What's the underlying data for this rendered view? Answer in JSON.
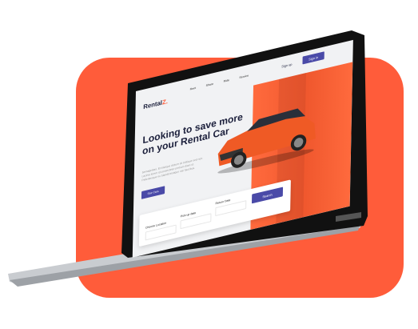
{
  "brand": {
    "name": "Rental",
    "suffix": "Z."
  },
  "nav": [
    "Rent",
    "Share",
    "Ride",
    "Service"
  ],
  "auth": {
    "sign_up": "Sign up",
    "sign_in": "Sign in"
  },
  "hero": {
    "title": "Looking to save more on your Rental Car",
    "description": "Semagestas. Et tristique dictum sit tristique sed non. Lacinia lorem id consectetur pretium diam ut. Pellentesque eu blandit tristique nisi faucibus.",
    "cta": "See Cars"
  },
  "search": {
    "location": "Choose Location",
    "pickup": "Pick-up date",
    "return": "Return Date",
    "button": "Search"
  },
  "colors": {
    "accent": "#FF5C3A",
    "primary": "#4a4aa8"
  }
}
